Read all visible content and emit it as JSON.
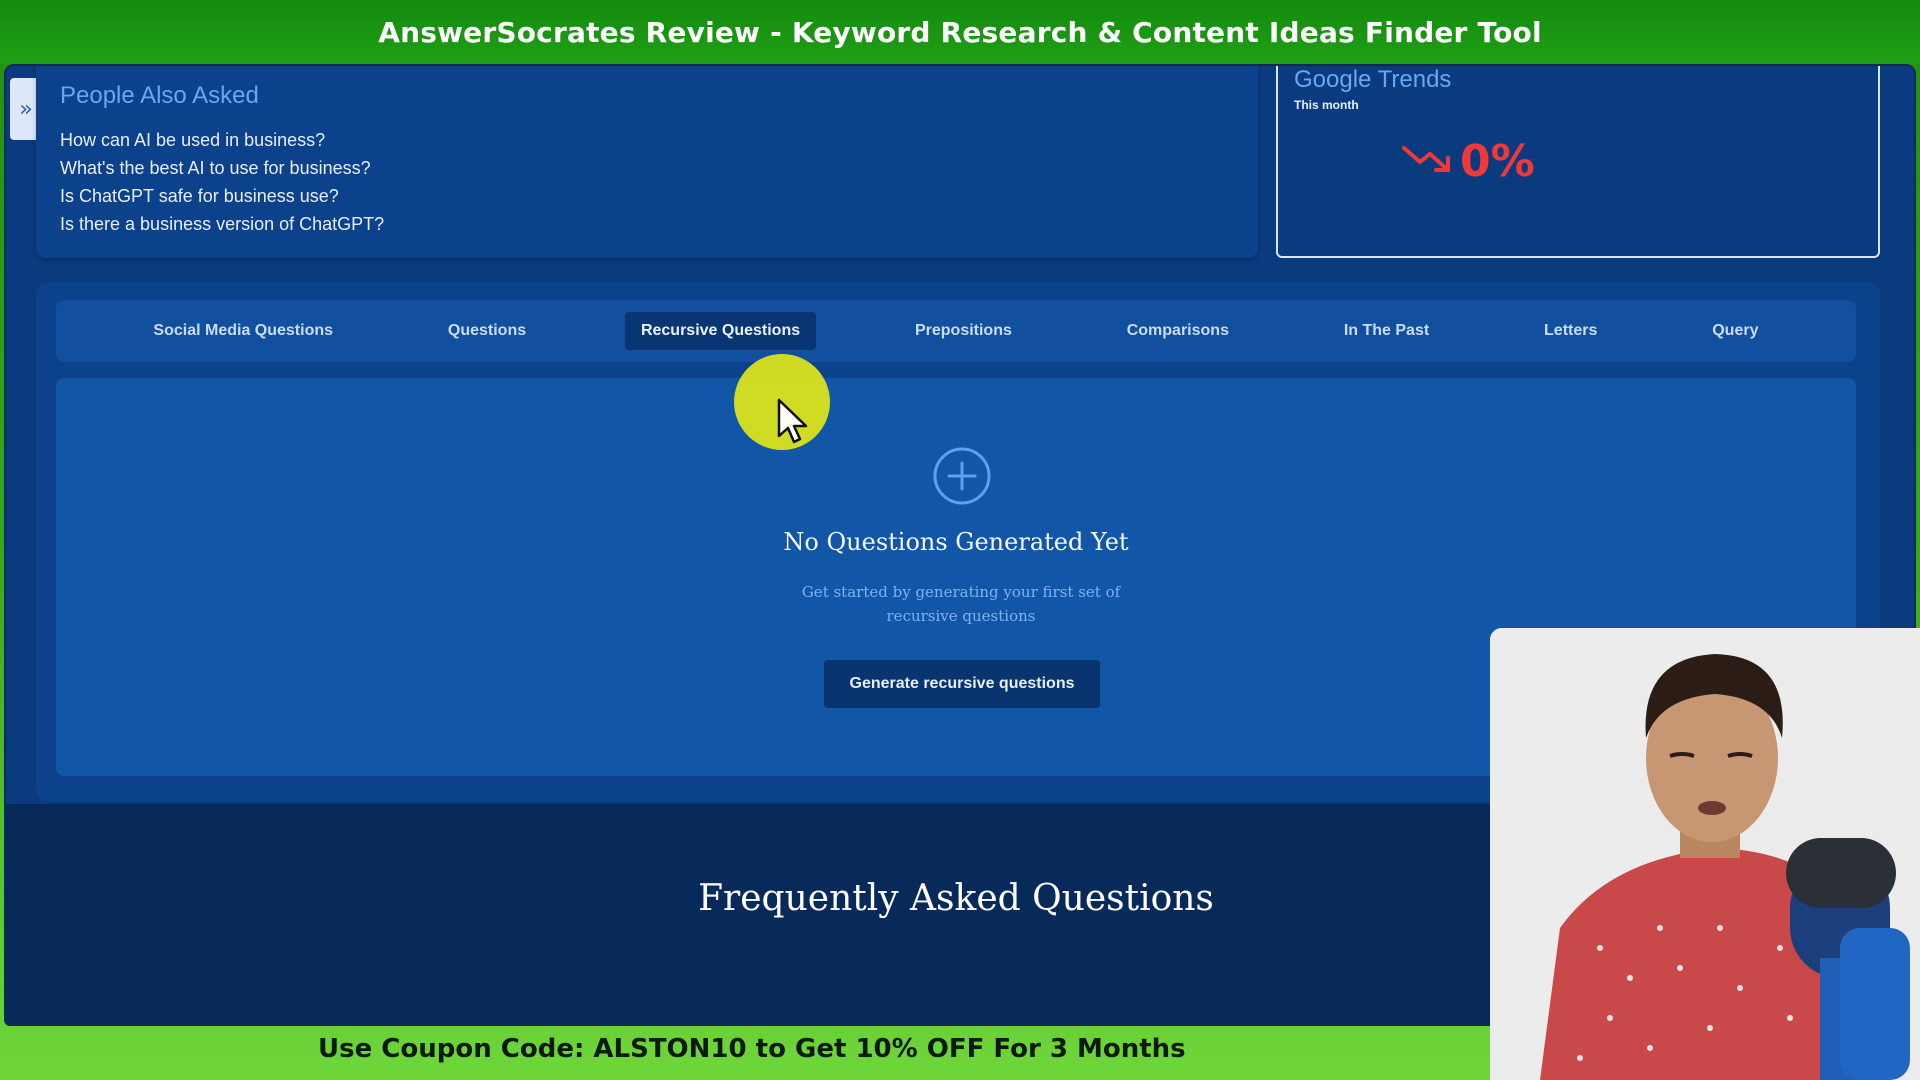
{
  "banner": {
    "title": "AnswerSocrates Review - Keyword Research & Content Ideas Finder Tool"
  },
  "sidebar": {
    "toggle_icon": "»"
  },
  "people_also_asked": {
    "title": "People Also Asked",
    "items": [
      "How can AI be used in business?",
      "What's the best AI to use for business?",
      "Is ChatGPT safe for business use?",
      "Is there a business version of ChatGPT?"
    ]
  },
  "google_trends": {
    "title": "Google Trends",
    "period": "This month",
    "value": "0%",
    "trend_icon": "trending-down-icon",
    "value_color": "#f0383a"
  },
  "tabs": [
    {
      "label": "Social Media Questions",
      "active": false
    },
    {
      "label": "Questions",
      "active": false
    },
    {
      "label": "Recursive Questions",
      "active": true
    },
    {
      "label": "Prepositions",
      "active": false
    },
    {
      "label": "Comparisons",
      "active": false
    },
    {
      "label": "In The Past",
      "active": false
    },
    {
      "label": "Letters",
      "active": false
    },
    {
      "label": "Query",
      "active": false
    }
  ],
  "empty_state": {
    "icon": "plus-circle-icon",
    "title": "No Questions Generated Yet",
    "description": "Get started by generating your first set of recursive questions",
    "button_label": "Generate recursive questions"
  },
  "faq": {
    "title": "Frequently Asked Questions"
  },
  "coupon": {
    "text": "Use Coupon Code: ALSTON10 to Get 10% OFF For 3 Months"
  },
  "colors": {
    "banner_green": "#1f8e12",
    "app_blue": "#0a3b7f",
    "accent_blue": "#6aa6f2",
    "trend_red": "#f0383a",
    "cursor_highlight": "#e1e619"
  }
}
